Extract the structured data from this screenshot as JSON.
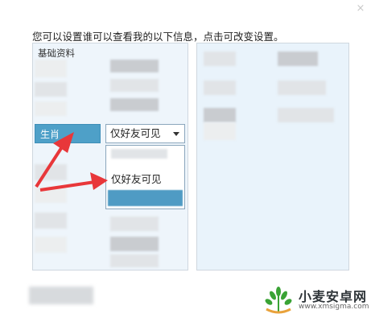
{
  "dialog": {
    "close_glyph": "×",
    "intro_text": "您可以设置谁可以查看我的以下信息，点击可改变设置。"
  },
  "left_panel": {
    "section_header": "基础资料",
    "selected_row_label": "生肖",
    "privacy_select_value": "仅好友可见",
    "dropdown_options": [
      "",
      "仅好友可见",
      ""
    ]
  },
  "watermark": {
    "title": "小麦安卓网",
    "url": "www.xmsigma.com"
  },
  "colors": {
    "selected_row": "#4ea0c8",
    "panel_bg": "#eef5fb",
    "arrow": "#e8373a",
    "watermark_green": "#3aa335"
  },
  "icons": [
    "close-icon",
    "chevron-down-icon",
    "red-arrow-icon",
    "wheat-logo-icon"
  ]
}
